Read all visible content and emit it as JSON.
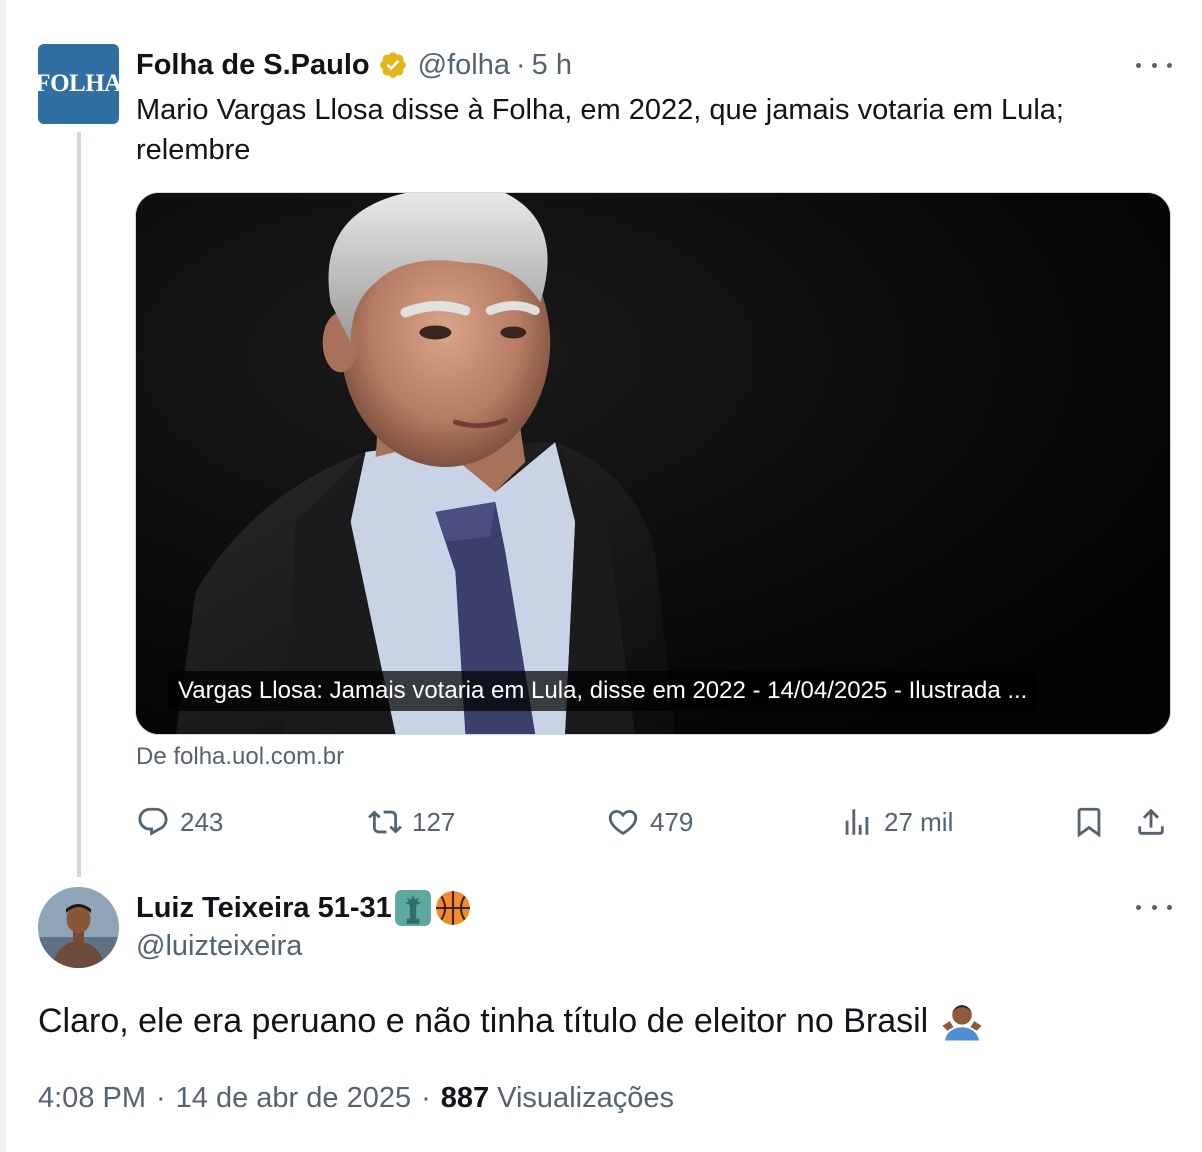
{
  "parent_tweet": {
    "avatar_text": "FOLHA",
    "author_name": "Folha de S.Paulo",
    "handle": "@folha",
    "separator": "·",
    "time": "5 h",
    "text": "Mario Vargas Llosa disse à Folha, em 2022, que jamais votaria em Lula; relembre",
    "card": {
      "caption": "Vargas Llosa: Jamais votaria em Lula, disse em 2022 - 14/04/2025 - Ilustrada ...",
      "source": "De folha.uol.com.br"
    },
    "actions": {
      "replies": "243",
      "retweets": "127",
      "likes": "479",
      "views": "27 mil"
    },
    "icons": {
      "verified": "gold-verified-badge-icon",
      "more": "more-dots-icon",
      "reply": "reply-bubble-icon",
      "retweet": "retweet-icon",
      "like": "heart-icon",
      "views": "views-bars-icon",
      "bookmark": "bookmark-icon",
      "share": "share-icon"
    }
  },
  "reply_tweet": {
    "author_name": "Luiz Teixeira 51-31",
    "name_emojis": [
      "statue-of-liberty-emoji",
      "basketball-emoji"
    ],
    "handle": "@luizteixeira",
    "text": "Claro, ele era peruano e não tinha título de eleitor no Brasil",
    "text_emoji": "person-shrugging-emoji",
    "time": "4:08 PM",
    "separator": "·",
    "date": "14 de abr de 2025",
    "views_count": "887",
    "views_label": "Visualizações"
  },
  "colors": {
    "text_primary": "#0f1419",
    "text_secondary": "#536471",
    "border": "#cfd9de",
    "verified_gold": "#e2b719",
    "folha_blue": "#2f6fa2"
  }
}
